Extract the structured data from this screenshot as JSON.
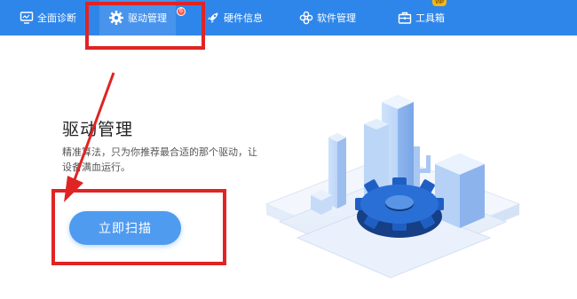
{
  "nav": {
    "items": [
      {
        "label": "全面诊断",
        "icon": "monitor-icon"
      },
      {
        "label": "驱动管理",
        "icon": "gear-icon",
        "active": true,
        "badge": "6"
      },
      {
        "label": "硬件信息",
        "icon": "rocket-icon"
      },
      {
        "label": "软件管理",
        "icon": "apps-icon"
      },
      {
        "label": "工具箱",
        "icon": "toolbox-icon",
        "tag": "VIP"
      }
    ]
  },
  "main": {
    "title": "驱动管理",
    "description": "精准算法，只为你推荐最合适的那个驱动，让设备满血运行。",
    "scan_button": "立即扫描"
  },
  "colors": {
    "nav_bg": "#2f86ea",
    "button_bg": "#4f9bf0",
    "annotation_red": "#e02424",
    "badge_red": "#ff5a45",
    "vip_gold": "#f2b619"
  }
}
